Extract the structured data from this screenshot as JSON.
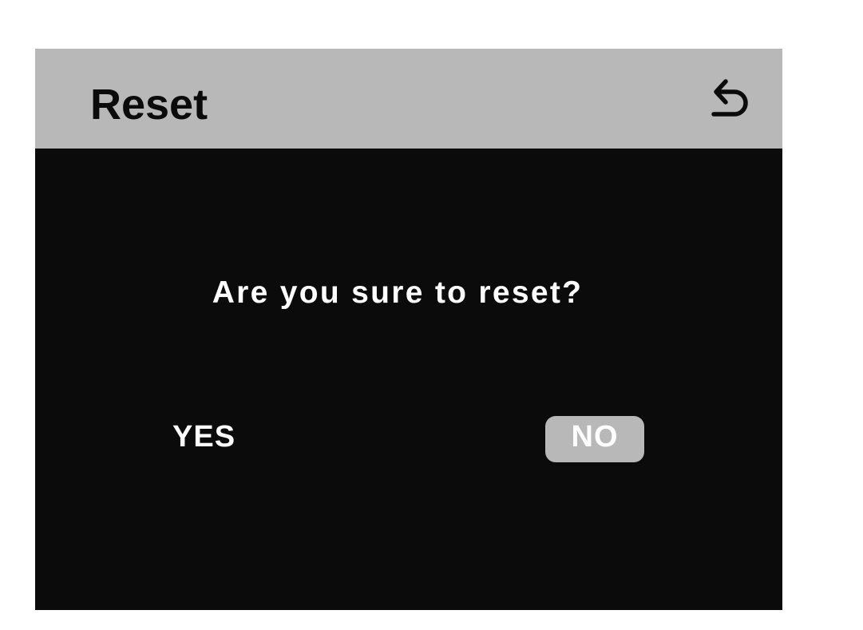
{
  "header": {
    "title": "Reset",
    "back_icon": "back-arrow-icon"
  },
  "dialog": {
    "question": "Are you sure to reset?",
    "yes_label": "YES",
    "no_label": "NO",
    "selected": "NO"
  },
  "colors": {
    "header_bg": "#b8b8b8",
    "body_bg": "#0b0b0b",
    "text_primary": "#ffffff",
    "selected_bg": "#b8b8b8"
  }
}
